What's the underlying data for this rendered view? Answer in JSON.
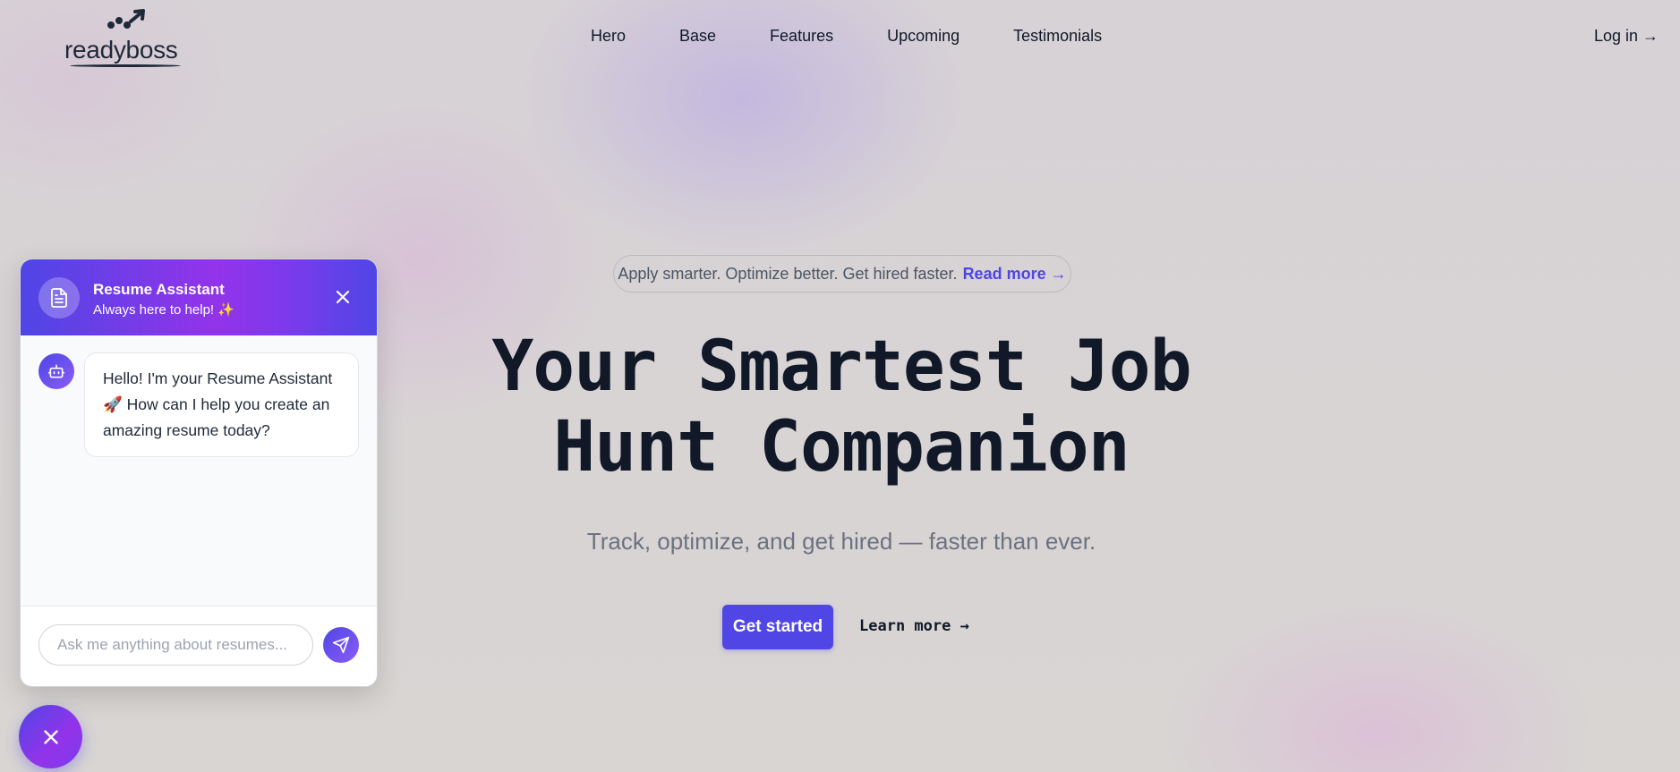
{
  "brand": {
    "name": "readyboss"
  },
  "nav": {
    "items": [
      {
        "label": "Hero"
      },
      {
        "label": "Base"
      },
      {
        "label": "Features"
      },
      {
        "label": "Upcoming"
      },
      {
        "label": "Testimonials"
      }
    ],
    "login_label": "Log in →"
  },
  "hero": {
    "pill_text": "Apply smarter. Optimize better. Get hired faster.",
    "pill_link": "Read more →",
    "title_line1": "Your Smartest Job",
    "title_line2": "Hunt Companion",
    "subtitle": "Track, optimize, and get hired — faster than ever.",
    "primary_button": "Get started",
    "secondary_button": "Learn more →"
  },
  "chat": {
    "title": "Resume Assistant",
    "status": "Always here to help! ✨",
    "message": "Hello! I'm your Resume Assistant 🚀 How can I help you create an amazing resume today?",
    "input_placeholder": "Ask me anything about resumes...",
    "icons": {
      "header": "document-icon",
      "close": "close-icon",
      "bot": "bot-icon",
      "send": "send-icon",
      "fab": "close-icon"
    }
  },
  "colors": {
    "accent": "#4f46e5",
    "accent_purple": "#9333ea",
    "text_dark": "#111827",
    "text_muted": "#6b7280"
  }
}
